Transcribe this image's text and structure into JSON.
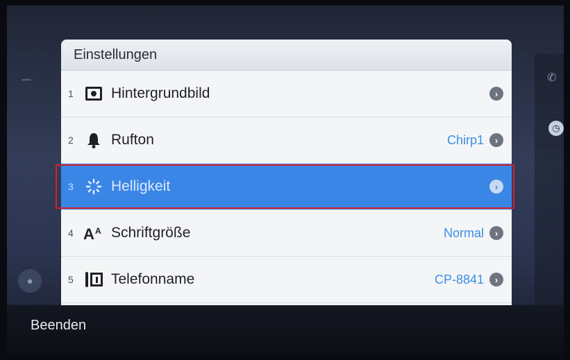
{
  "panel": {
    "title": "Einstellungen",
    "items": [
      {
        "num": "1",
        "icon": "wallpaper-icon",
        "label": "Hintergrundbild",
        "value": ""
      },
      {
        "num": "2",
        "icon": "bell-icon",
        "label": "Rufton",
        "value": "Chirp1"
      },
      {
        "num": "3",
        "icon": "brightness-icon",
        "label": "Helligkeit",
        "value": "",
        "selected": true
      },
      {
        "num": "4",
        "icon": "font-size-icon",
        "label": "Schriftgröße",
        "value": "Normal"
      },
      {
        "num": "5",
        "icon": "phone-name-icon",
        "label": "Telefonname",
        "value": "CP-8841"
      }
    ]
  },
  "softkeys": {
    "exit_label": "Beenden"
  },
  "colors": {
    "selection": "#3a86e6",
    "value_text": "#3a8ee6",
    "highlight_border": "#d91e2a"
  }
}
